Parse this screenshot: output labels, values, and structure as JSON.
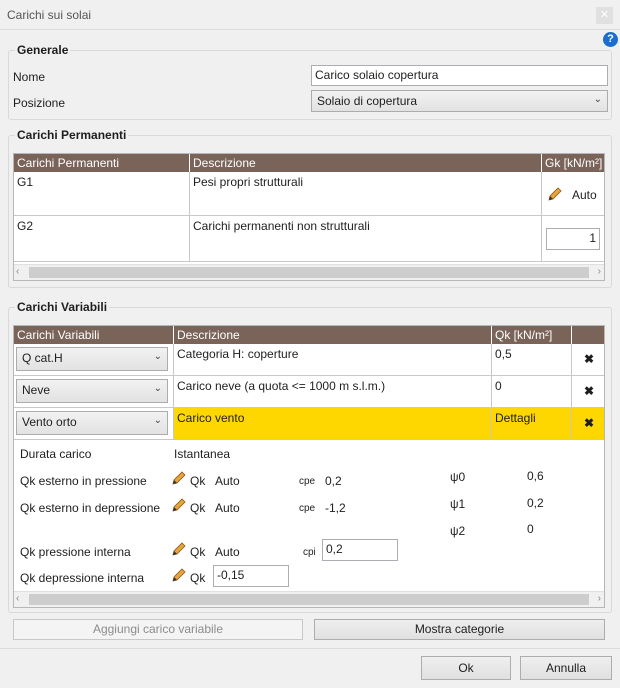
{
  "window": {
    "title": "Carichi sui solai",
    "close_glyph": "✕"
  },
  "generale": {
    "title": "Generale",
    "nome_label": "Nome",
    "nome_value": "Carico solaio copertura",
    "posizione_label": "Posizione",
    "posizione_value": "Solaio di copertura"
  },
  "permanenti": {
    "title": "Carichi Permanenti",
    "headers": [
      "Carichi Permanenti",
      "Descrizione",
      "Gk [kN/m²]"
    ],
    "rows": [
      {
        "name": "G1",
        "desc": "Pesi propri strutturali",
        "value": "Auto"
      },
      {
        "name": "G2",
        "desc": "Carichi permanenti non strutturali",
        "value": "1"
      }
    ]
  },
  "variabili": {
    "title": "Carichi Variabili",
    "headers": [
      "Carichi Variabili",
      "Descrizione",
      "Qk [kN/m²]"
    ],
    "rows": [
      {
        "name": "Q cat.H",
        "desc": "Categoria H: coperture",
        "value": "0,5"
      },
      {
        "name": "Neve",
        "desc": "Carico neve (a quota <= 1000 m s.l.m.)",
        "value": "0"
      },
      {
        "name": "Vento orto",
        "desc": "Carico vento",
        "value": "Dettagli"
      }
    ],
    "details": {
      "durata_label": "Durata carico",
      "durata_value": "Istantanea",
      "ext_press_label": "Qk esterno in pressione",
      "ext_dep_label": "Qk esterno in depressione",
      "int_press_label": "Qk pressione interna",
      "int_dep_label": "Qk depressione interna",
      "qk": "Qk",
      "auto": "Auto",
      "cpe_label": "cpe",
      "cpi_label": "cpi",
      "cpe_pressione": "0,2",
      "cpe_depressione": "-1,2",
      "cpi_value": "0,2",
      "int_dep_value": "-0,15",
      "psi0_label": "ψ0",
      "psi1_label": "ψ1",
      "psi2_label": "ψ2",
      "psi0": "0,6",
      "psi1": "0,2",
      "psi2": "0"
    }
  },
  "buttons": {
    "aggiungi": "Aggiungi carico variabile",
    "mostra": "Mostra categorie",
    "ok": "Ok",
    "annulla": "Annulla"
  },
  "icons": {
    "help": "?",
    "delete": "✖",
    "dropdown": "⌄",
    "left": "‹",
    "right": "›"
  },
  "colors": {
    "header": "#7a645a",
    "highlight": "#ffd700",
    "help": "#1c6dd0"
  }
}
